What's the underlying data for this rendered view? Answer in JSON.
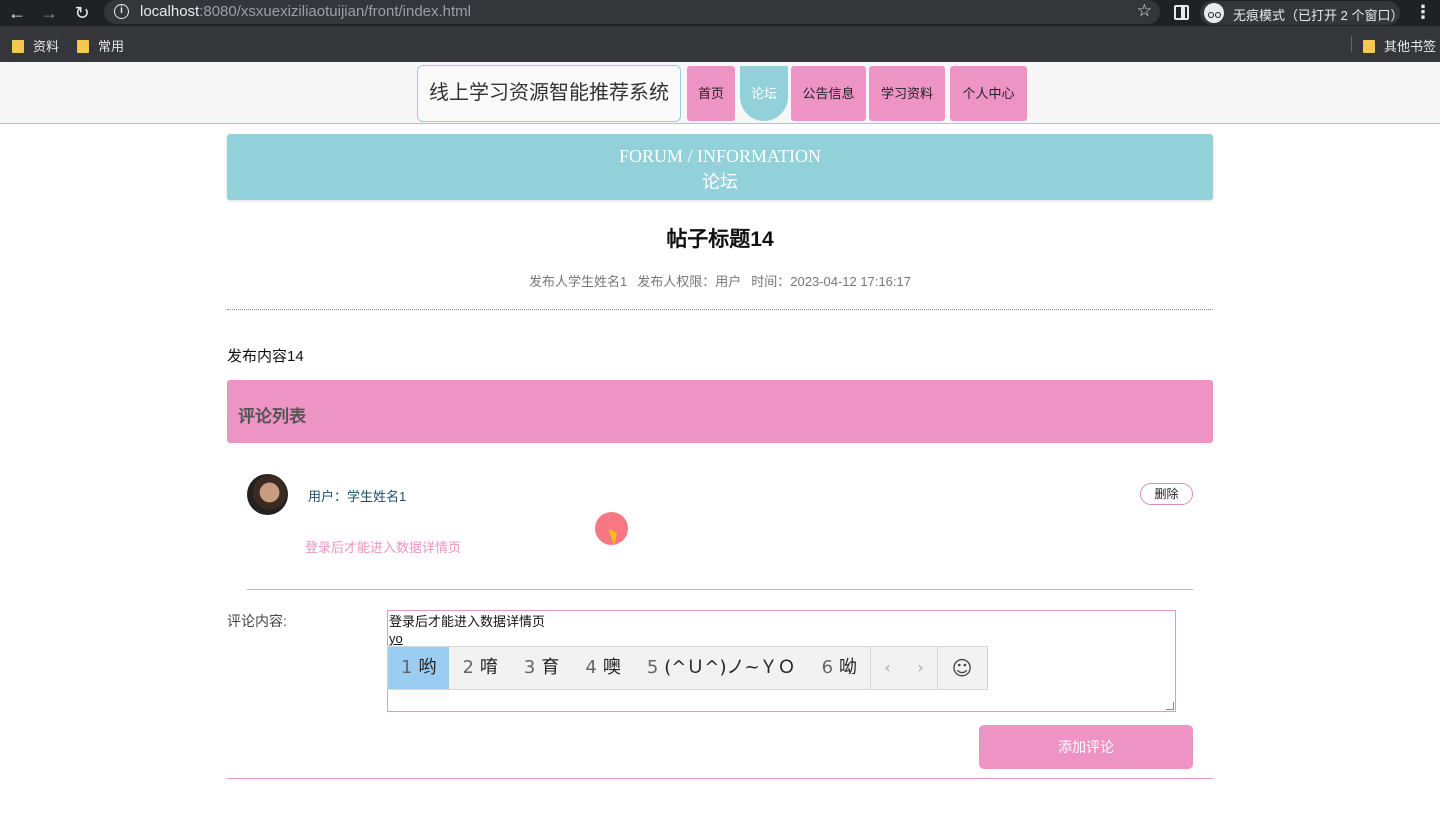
{
  "browser": {
    "url_host": "localhost",
    "url_rest": ":8080/xsxuexiziliaotuijian/front/index.html",
    "incognito_label": "无痕模式（已打开 2 个窗口）",
    "bookmarks": [
      "资料",
      "常用"
    ],
    "other_bookmarks": "其他书签"
  },
  "site": {
    "brand": "线上学习资源智能推荐系统",
    "nav": [
      "首页",
      "论坛",
      "公告信息",
      "学习资料",
      "个人中心"
    ],
    "active_nav": "论坛"
  },
  "banner": {
    "en": "FORUM / INFORMATION",
    "zh": "论坛"
  },
  "post": {
    "title": "帖子标题14",
    "author": "发布人学生姓名1",
    "role": "发布人权限：用户",
    "time": "时间：2023-04-12 17:16:17",
    "content": "发布内容14"
  },
  "comments": {
    "header": "评论列表",
    "items": [
      {
        "user": "用户：学生姓名1",
        "text": "登录后才能进入数据详情页",
        "delete_label": "删除"
      }
    ]
  },
  "form": {
    "label": "评论内容:",
    "value_line1": "登录后才能进入数据详情页",
    "value_line2": "yo",
    "submit_label": "添加评论"
  },
  "ime": {
    "candidates": [
      {
        "n": "1",
        "text": "哟"
      },
      {
        "n": "2",
        "text": "唷"
      },
      {
        "n": "3",
        "text": "育"
      },
      {
        "n": "4",
        "text": "噢"
      },
      {
        "n": "5",
        "text": "(^Ｕ^)ノ~ＹＯ"
      },
      {
        "n": "6",
        "text": "呦"
      }
    ],
    "selected": "1"
  },
  "colors": {
    "accent_pink": "#ee94c4",
    "accent_teal": "#93d1da"
  }
}
